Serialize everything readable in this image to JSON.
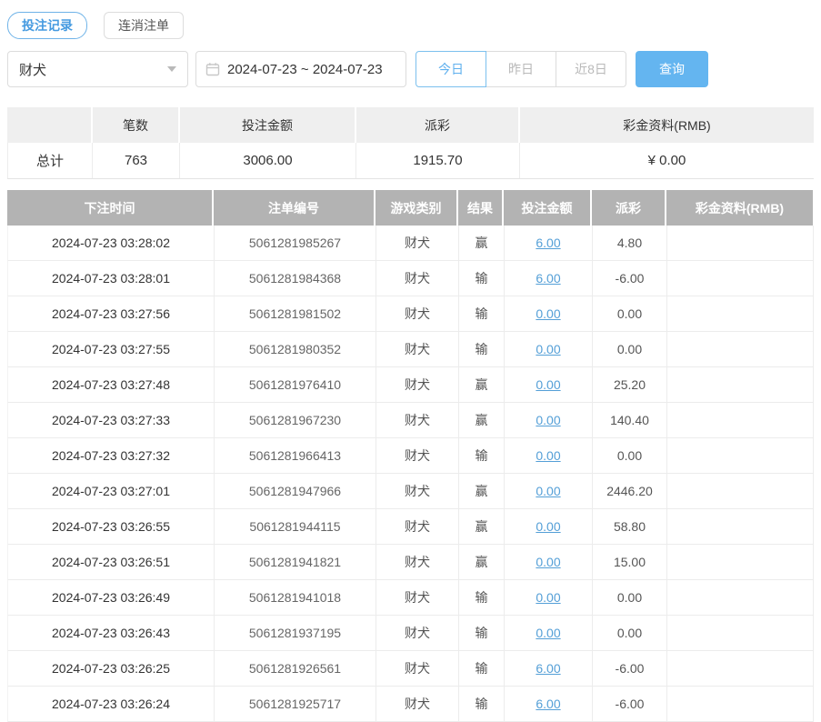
{
  "tabs": [
    {
      "label": "投注记录",
      "active": true
    },
    {
      "label": "连消注单",
      "active": false
    }
  ],
  "filters": {
    "game_select": {
      "value": "财犬"
    },
    "date_range": "2024-07-23 ~ 2024-07-23",
    "quick_ranges": [
      {
        "label": "今日",
        "active": true
      },
      {
        "label": "昨日",
        "active": false
      },
      {
        "label": "近8日",
        "active": false
      }
    ],
    "query_label": "查询"
  },
  "summary": {
    "columns": [
      "",
      "笔数",
      "投注金额",
      "派彩",
      "彩金资料(RMB)"
    ],
    "row_label": "总计",
    "count": "763",
    "bet_amount": "3006.00",
    "payout": "1915.70",
    "bonus": "¥ 0.00"
  },
  "table": {
    "columns": [
      "下注时间",
      "注单编号",
      "游戏类别",
      "结果",
      "投注金额",
      "派彩",
      "彩金资料(RMB)"
    ],
    "rows": [
      {
        "time": "2024-07-23 03:28:02",
        "bet_id": "5061281985267",
        "game": "财犬",
        "result": "赢",
        "amount": "6.00",
        "payout": "4.80",
        "bonus": ""
      },
      {
        "time": "2024-07-23 03:28:01",
        "bet_id": "5061281984368",
        "game": "财犬",
        "result": "输",
        "amount": "6.00",
        "payout": "-6.00",
        "bonus": ""
      },
      {
        "time": "2024-07-23 03:27:56",
        "bet_id": "5061281981502",
        "game": "财犬",
        "result": "输",
        "amount": "0.00",
        "payout": "0.00",
        "bonus": ""
      },
      {
        "time": "2024-07-23 03:27:55",
        "bet_id": "5061281980352",
        "game": "财犬",
        "result": "输",
        "amount": "0.00",
        "payout": "0.00",
        "bonus": ""
      },
      {
        "time": "2024-07-23 03:27:48",
        "bet_id": "5061281976410",
        "game": "财犬",
        "result": "赢",
        "amount": "0.00",
        "payout": "25.20",
        "bonus": ""
      },
      {
        "time": "2024-07-23 03:27:33",
        "bet_id": "5061281967230",
        "game": "财犬",
        "result": "赢",
        "amount": "0.00",
        "payout": "140.40",
        "bonus": ""
      },
      {
        "time": "2024-07-23 03:27:32",
        "bet_id": "5061281966413",
        "game": "财犬",
        "result": "输",
        "amount": "0.00",
        "payout": "0.00",
        "bonus": ""
      },
      {
        "time": "2024-07-23 03:27:01",
        "bet_id": "5061281947966",
        "game": "财犬",
        "result": "赢",
        "amount": "0.00",
        "payout": "2446.20",
        "bonus": ""
      },
      {
        "time": "2024-07-23 03:26:55",
        "bet_id": "5061281944115",
        "game": "财犬",
        "result": "赢",
        "amount": "0.00",
        "payout": "58.80",
        "bonus": ""
      },
      {
        "time": "2024-07-23 03:26:51",
        "bet_id": "5061281941821",
        "game": "财犬",
        "result": "赢",
        "amount": "0.00",
        "payout": "15.00",
        "bonus": ""
      },
      {
        "time": "2024-07-23 03:26:49",
        "bet_id": "5061281941018",
        "game": "财犬",
        "result": "输",
        "amount": "0.00",
        "payout": "0.00",
        "bonus": ""
      },
      {
        "time": "2024-07-23 03:26:43",
        "bet_id": "5061281937195",
        "game": "财犬",
        "result": "输",
        "amount": "0.00",
        "payout": "0.00",
        "bonus": ""
      },
      {
        "time": "2024-07-23 03:26:25",
        "bet_id": "5061281926561",
        "game": "财犬",
        "result": "输",
        "amount": "6.00",
        "payout": "-6.00",
        "bonus": ""
      },
      {
        "time": "2024-07-23 03:26:24",
        "bet_id": "5061281925717",
        "game": "财犬",
        "result": "输",
        "amount": "6.00",
        "payout": "-6.00",
        "bonus": ""
      }
    ]
  },
  "colors": {
    "accent_blue": "#5fb0ee",
    "query_button_bg": "#64b5f0",
    "link_blue": "#549fd7",
    "negative_red": "#ef5b5b",
    "table_header_bg": "#b3b3b3",
    "summary_header_bg": "#efefef"
  }
}
